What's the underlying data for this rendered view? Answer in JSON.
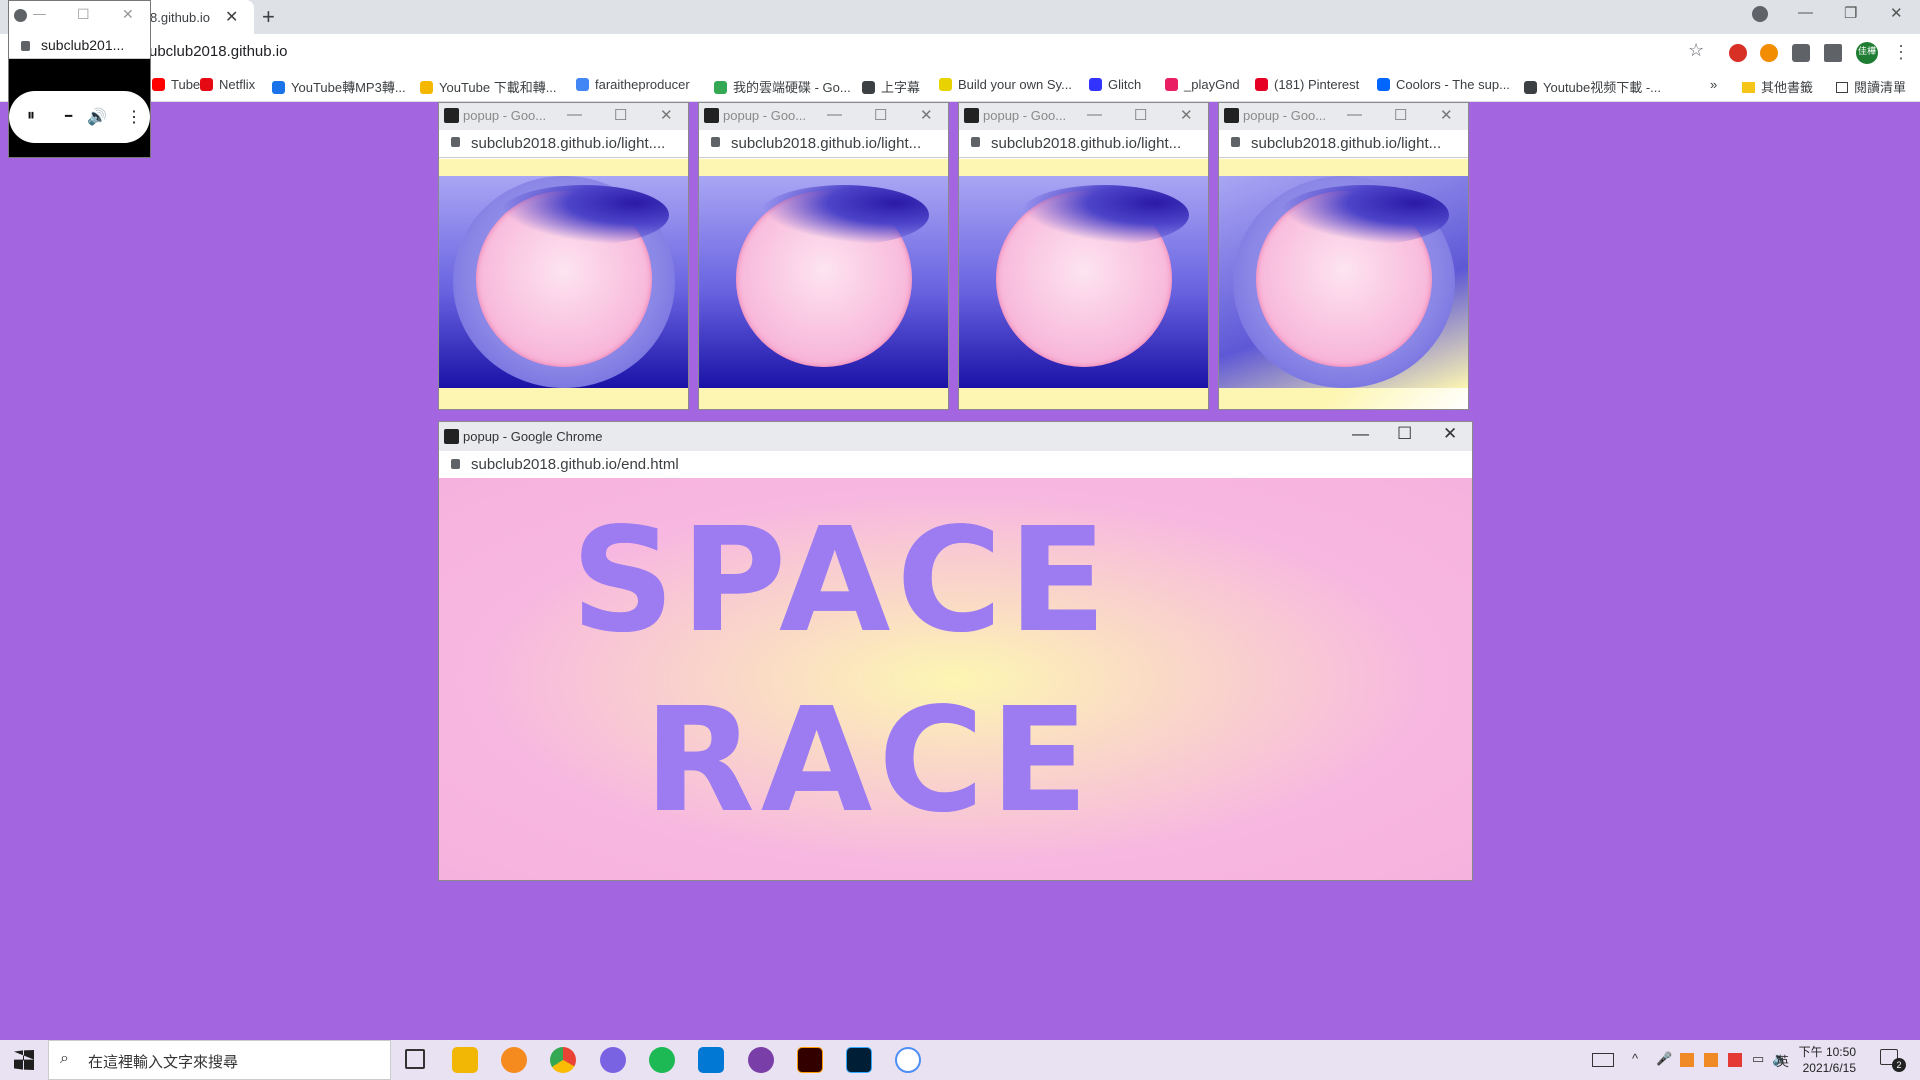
{
  "browser": {
    "tab_title": "8.github.io",
    "url": "ubclub2018.github.io",
    "bookmarks": [
      {
        "label": "Tube",
        "color": "#ff0000"
      },
      {
        "label": "Netflix",
        "color": "#e50914"
      },
      {
        "label": "YouTube轉MP3轉...",
        "color": "#1a73e8"
      },
      {
        "label": "YouTube 下載和轉...",
        "color": "#f5b800"
      },
      {
        "label": "faraitheproducer",
        "color": "#4285f4"
      },
      {
        "label": "我的雲端硬碟 - Go...",
        "color": "#34a853"
      },
      {
        "label": "上字幕",
        "color": "#3c4043"
      },
      {
        "label": "Build your own Sy...",
        "color": "#e8d200"
      },
      {
        "label": "Glitch",
        "color": "#3333ff"
      },
      {
        "label": "_playGnd",
        "color": "#e91e63"
      },
      {
        "label": "(181) Pinterest",
        "color": "#e60023"
      },
      {
        "label": "Coolors - The sup...",
        "color": "#0066ff"
      },
      {
        "label": "Youtube视频下載 -...",
        "color": "#3c4043"
      }
    ],
    "bookmarks_overflow": "»",
    "other_bookmarks": "其他書籤",
    "reading_list": "閱讀清單",
    "profile_label": "佳樺"
  },
  "mini_player": {
    "url": "subclub201...",
    "pause_icon": "⏸",
    "minus_icon": "━",
    "volume_icon": "🔊",
    "more_icon": "⋮"
  },
  "popups": [
    {
      "title": "popup - Goo...",
      "url": "subclub2018.github.io/light...."
    },
    {
      "title": "popup - Goo...",
      "url": "subclub2018.github.io/light..."
    },
    {
      "title": "popup - Goo...",
      "url": "subclub2018.github.io/light..."
    },
    {
      "title": "popup - Goo...",
      "url": "subclub2018.github.io/light..."
    }
  ],
  "end_popup": {
    "title": "popup - Google Chrome",
    "url": "subclub2018.github.io/end.html",
    "line1": "SPACE",
    "line2": "RACE"
  },
  "taskbar": {
    "search_placeholder": "在這裡輸入文字來搜尋",
    "time": "下午 10:50",
    "date": "2021/6/15",
    "ime": "英",
    "notifications": "2"
  }
}
